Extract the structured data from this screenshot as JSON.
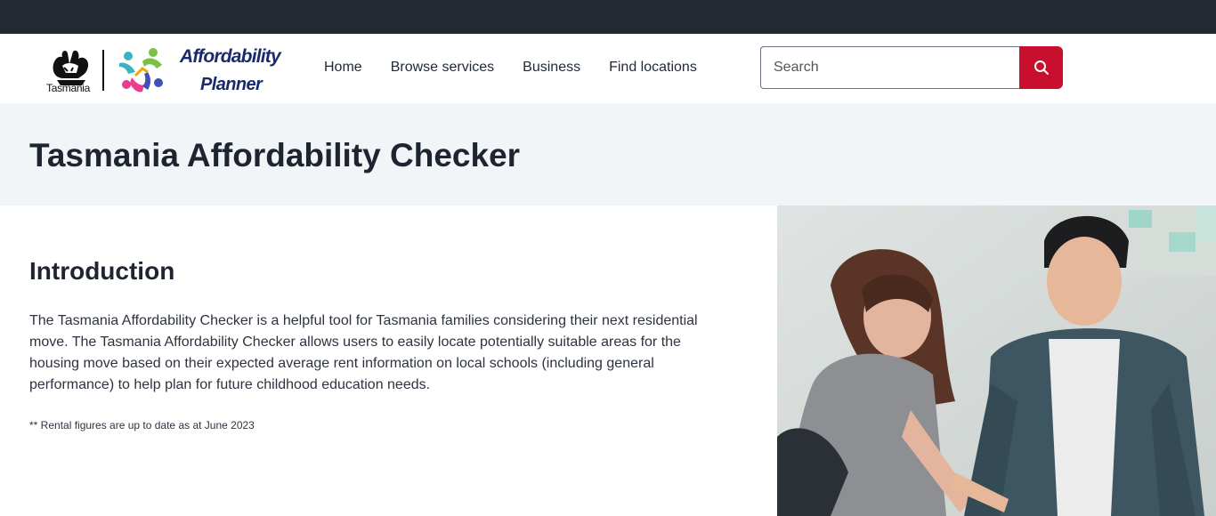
{
  "brand": {
    "gov_name": "Tasmania",
    "product_line1": "Affordability",
    "product_line2": "Planner",
    "emblem_icon": "tasmania-coat-of-arms-icon",
    "mark_icon": "affordability-planner-figures-icon"
  },
  "nav": {
    "items": [
      "Home",
      "Browse services",
      "Business",
      "Find locations"
    ]
  },
  "search": {
    "placeholder": "Search",
    "value": "",
    "button_icon": "search-icon"
  },
  "page": {
    "title": "Tasmania Affordability Checker"
  },
  "intro": {
    "heading": "Introduction",
    "paragraph": "The Tasmania Affordability Checker is a helpful tool for Tasmania families considering their next residential move. The Tasmania Affordability Checker allows users to easily locate potentially suitable areas for the housing move based on their expected average rent information on local schools (including general performance) to help plan for future childhood education needs.",
    "note": "** Rental figures are up to date as at June 2023"
  },
  "colors": {
    "topbar": "#242833",
    "accent_red": "#c8102e",
    "title_band": "#f1f5f8",
    "brand_navy": "#1a2a6c"
  }
}
